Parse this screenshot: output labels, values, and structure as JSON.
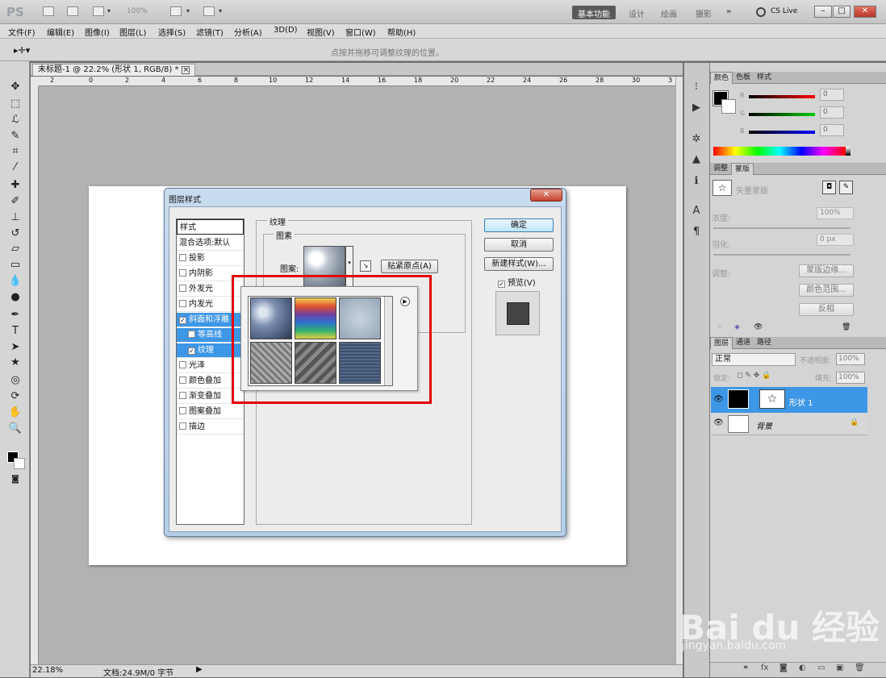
{
  "app": {
    "logo": "PS",
    "zoom_menu": "100%",
    "workspaces": [
      "基本功能",
      "设计",
      "绘画",
      "摄影"
    ],
    "more": "»",
    "cslive": "CS Live",
    "win_min": "–",
    "win_max": "□",
    "win_close": "✕"
  },
  "menu": [
    "文件(F)",
    "编辑(E)",
    "图像(I)",
    "图层(L)",
    "选择(S)",
    "滤镜(T)",
    "分析(A)",
    "3D(D)",
    "视图(V)",
    "窗口(W)",
    "帮助(H)"
  ],
  "options": {
    "hint": "点按并拖移可调整纹理的位置。"
  },
  "document": {
    "tab_title": "未标题-1 @ 22.2% (形状 1, RGB/8) *",
    "zoom": "22.18%",
    "doc_info": "文档:24.9M/0 字节"
  },
  "ruler_top": [
    "2",
    "0",
    "2",
    "4",
    "6",
    "8",
    "10",
    "12",
    "14",
    "16",
    "18",
    "20",
    "22",
    "24",
    "26",
    "28",
    "30",
    "3"
  ],
  "dialog": {
    "title": "图层样式",
    "close": "✕",
    "styles_header": "样式",
    "blend_options": "混合选项:默认",
    "items": [
      {
        "label": "投影",
        "checked": false
      },
      {
        "label": "内阴影",
        "checked": false
      },
      {
        "label": "外发光",
        "checked": false
      },
      {
        "label": "内发光",
        "checked": false
      },
      {
        "label": "斜面和浮雕",
        "checked": true
      },
      {
        "label": "等高线",
        "checked": false
      },
      {
        "label": "纹理",
        "checked": true
      },
      {
        "label": "光泽",
        "checked": false
      },
      {
        "label": "颜色叠加",
        "checked": false
      },
      {
        "label": "渐变叠加",
        "checked": false
      },
      {
        "label": "图案叠加",
        "checked": false
      },
      {
        "label": "描边",
        "checked": false
      }
    ],
    "group_texture": "纹理",
    "group_pattern": "图素",
    "pattern_label": "图案:",
    "snap_button": "贴紧原点(A)",
    "ok": "确定",
    "cancel": "取消",
    "new_style": "新建样式(W)...",
    "preview": "预览(V)"
  },
  "right": {
    "color_tabs": [
      "颜色",
      "色板",
      "样式"
    ],
    "rgb": {
      "r_label": "R",
      "g_label": "G",
      "b_label": "B",
      "r": "0",
      "g": "0",
      "b": "0"
    },
    "adj_tabs": [
      "调整",
      "蒙版"
    ],
    "mask_label": "矢量蒙版",
    "density_label": "浓度:",
    "density": "100%",
    "feather_label": "羽化:",
    "feather": "0 px",
    "refine_label": "调整:",
    "mask_edge": "蒙版边缘...",
    "color_range": "颜色范围...",
    "invert": "反相",
    "layer_tabs": [
      "图层",
      "通道",
      "路径"
    ],
    "blend_mode": "正常",
    "opacity_label": "不透明度:",
    "opacity": "100%",
    "lock_label": "锁定:",
    "fill_label": "填充:",
    "fill": "100%",
    "layers": [
      {
        "name": "形状 1",
        "selected": true
      },
      {
        "name": "背景",
        "selected": false
      }
    ]
  },
  "watermark": {
    "brand": "Bai du 经验",
    "url": "jingyan.baidu.com"
  }
}
